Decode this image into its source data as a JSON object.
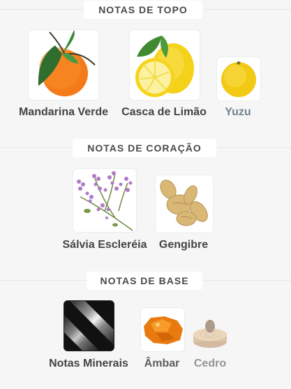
{
  "sections": {
    "top": {
      "title": "NOTAS DE TOPO",
      "notes": [
        {
          "name": "Mandarina Verde",
          "icon": "mandarin-icon"
        },
        {
          "name": "Casca de Limão",
          "icon": "lemon-icon"
        },
        {
          "name": "Yuzu",
          "icon": "yuzu-icon"
        }
      ]
    },
    "heart": {
      "title": "NOTAS DE CORAÇÃO",
      "notes": [
        {
          "name": "Sálvia Escleréia",
          "icon": "clary-sage-icon"
        },
        {
          "name": "Gengibre",
          "icon": "ginger-icon"
        }
      ]
    },
    "base": {
      "title": "NOTAS DE BASE",
      "notes": [
        {
          "name": "Notas Minerais",
          "icon": "mineral-icon"
        },
        {
          "name": "Âmbar",
          "icon": "amber-icon"
        },
        {
          "name": "Cedro",
          "icon": "cedar-icon"
        }
      ]
    }
  },
  "colors": {
    "background": "#f6f6f6",
    "title_background": "#ffffff",
    "label_text": "#444444",
    "faded_label_text": "#8a8a8a"
  }
}
